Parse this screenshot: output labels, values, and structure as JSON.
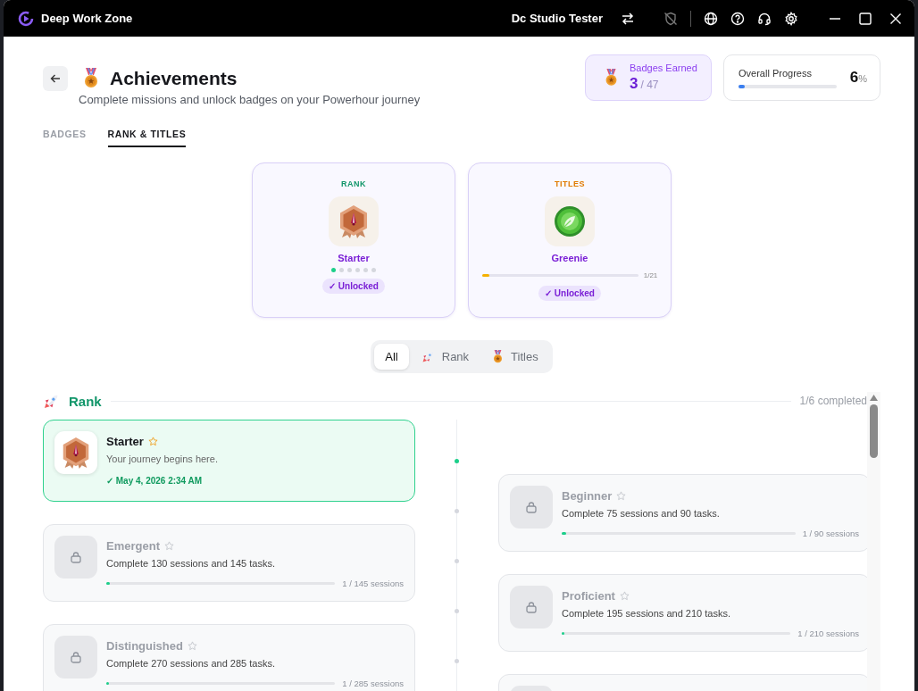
{
  "window": {
    "title": "Deep Work Zone",
    "user": "Dc Studio Tester"
  },
  "header": {
    "title": "Achievements",
    "subtitle": "Complete missions and unlock badges on your Powerhour journey"
  },
  "stats": {
    "badges_label": "Badges Earned",
    "badges_earned": "3",
    "badges_total": "/ 47",
    "progress_label": "Overall Progress",
    "progress_value": "6",
    "progress_unit": "%",
    "level": 0.06
  },
  "tabs": [
    {
      "label": "BADGES",
      "selected": false
    },
    {
      "label": "RANK & TITLES",
      "selected": true
    }
  ],
  "summary": [
    {
      "kind": "rank",
      "heading": "RANK",
      "name": "Starter",
      "steps": [
        {
          "done": true
        },
        {
          "done": false
        },
        {
          "done": false
        },
        {
          "done": false
        },
        {
          "done": false
        },
        {
          "done": false
        }
      ],
      "status": "✓ Unlocked"
    },
    {
      "kind": "title",
      "heading": "TITLES",
      "name": "Greenie",
      "level": 0.05,
      "count": "1/21",
      "status": "✓ Unlocked"
    }
  ],
  "filters": [
    {
      "kind": "all",
      "label": "All",
      "selected": true
    },
    {
      "kind": "rank",
      "label": "Rank",
      "selected": false
    },
    {
      "kind": "titles",
      "label": "Titles",
      "selected": false
    }
  ],
  "section": {
    "title": "Rank",
    "completed": "1/6 completed"
  },
  "ranks": [
    {
      "kind": "unlocked",
      "name": "Starter",
      "description": "Your journey begins here.",
      "date": "✓ May 4, 2026 2:34 AM"
    },
    {
      "kind": "locked",
      "name": "Beginner",
      "description": "Complete 75 sessions and 90 tasks.",
      "level": 0.011,
      "progress": "1 / 90 sessions"
    },
    {
      "kind": "locked",
      "name": "Emergent",
      "description": "Complete 130 sessions and 145 tasks.",
      "level": 0.007,
      "progress": "1 / 145 sessions"
    },
    {
      "kind": "locked",
      "name": "Proficient",
      "description": "Complete 195 sessions and 210 tasks.",
      "level": 0.005,
      "progress": "1 / 210 sessions"
    },
    {
      "kind": "locked",
      "name": "Distinguished",
      "description": "Complete 270 sessions and 285 tasks.",
      "level": 0.0035,
      "progress": "1 / 285 sessions"
    },
    {
      "kind": "locked"
    }
  ]
}
